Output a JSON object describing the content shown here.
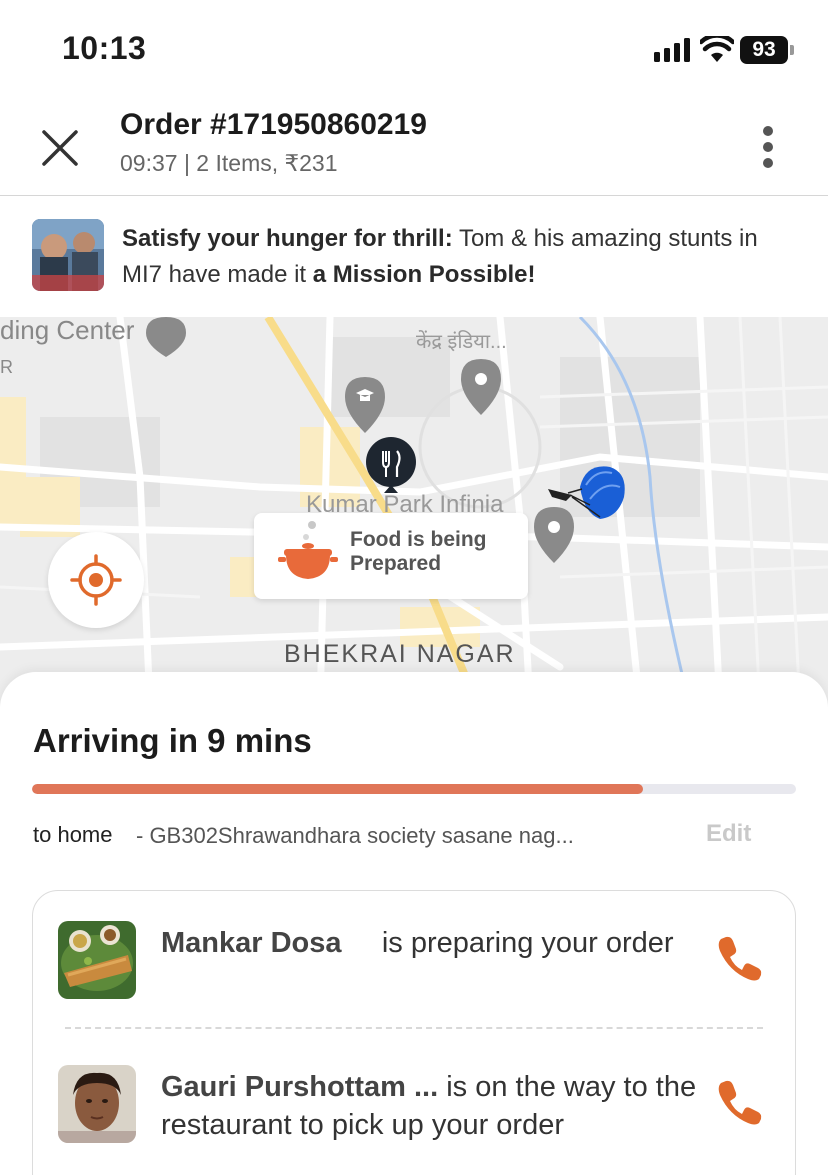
{
  "status_bar": {
    "time": "10:13",
    "battery": "93"
  },
  "header": {
    "order_title": "Order #171950860219",
    "order_sub": "09:37 | 2 Items, ₹231"
  },
  "promo": {
    "bold_lead": "Satisfy your hunger for thrill:",
    "text_mid": " Tom & his amazing stunts in MI7 have made it ",
    "bold_tail": "a Mission Possible!"
  },
  "map": {
    "labels": {
      "building_center": "ding Center",
      "kendra_india": "केंद्र इंडिया...",
      "kumar_park": "Kumar Park Infinia",
      "bhekrai": "BHEKRAI NAGAR",
      "r_edge": "R"
    },
    "food_status": "Food is being Prepared"
  },
  "delivery": {
    "arriving": "Arriving in 9 mins",
    "progress_percent": 80,
    "to_label": "to home",
    "address": "- GB302Shrawandhara society sasane nag...",
    "edit_label": "Edit"
  },
  "restaurant": {
    "name": "Mankar Dosa",
    "status": "is preparing your order"
  },
  "rider": {
    "name": "Gauri Purshottam ...",
    "status": "is on the way to the restaurant to pick up your order"
  },
  "colors": {
    "accent": "#e07658",
    "phone": "#e06a2c"
  }
}
